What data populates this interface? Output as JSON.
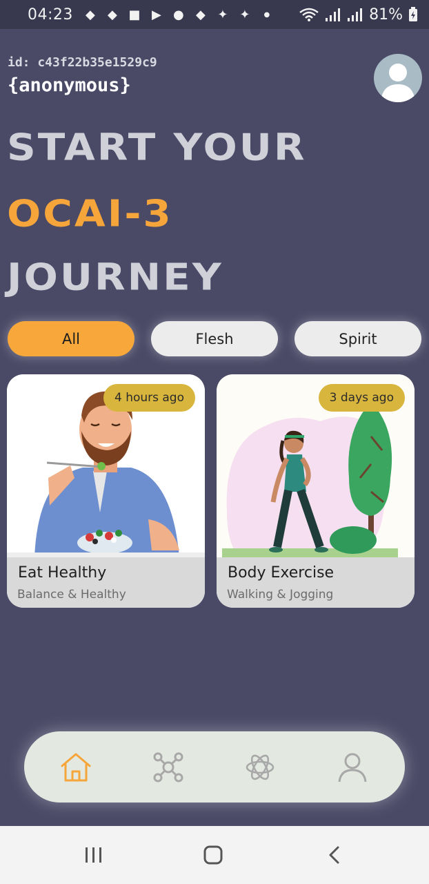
{
  "status_bar": {
    "time": "04:23",
    "battery": "81%",
    "icons": [
      "incognito-icon",
      "incognito-icon",
      "gift-icon",
      "youtube-icon",
      "robot-icon",
      "incognito-icon",
      "bird-icon",
      "bird-icon",
      "dot-icon",
      "wifi-icon",
      "signal-icon",
      "signal-icon",
      "battery-icon"
    ]
  },
  "header": {
    "user_id": "id: c43f22b35e1529c9",
    "user_name": "{anonymous}"
  },
  "hero": {
    "line1": "START YOUR",
    "line2": "OCAI-3",
    "line3": "JOURNEY"
  },
  "filters": {
    "selected": "All",
    "tabs": [
      {
        "label": "All"
      },
      {
        "label": "Flesh"
      },
      {
        "label": "Spirit"
      }
    ]
  },
  "cards": [
    {
      "title": "Eat Healthy",
      "subtitle": "Balance & Healthy",
      "time": "4 hours ago"
    },
    {
      "title": "Body Exercise",
      "subtitle": "Walking & Jogging",
      "time": "3 days ago"
    }
  ],
  "bottom_nav": {
    "active": "home",
    "items": [
      "home-icon",
      "network-icon",
      "openai-icon",
      "profile-icon"
    ]
  },
  "colors": {
    "background": "#4a4a67",
    "accent": "#f8a83a",
    "badge": "#d8b53c",
    "nav_bar": "#e3e9e0"
  }
}
